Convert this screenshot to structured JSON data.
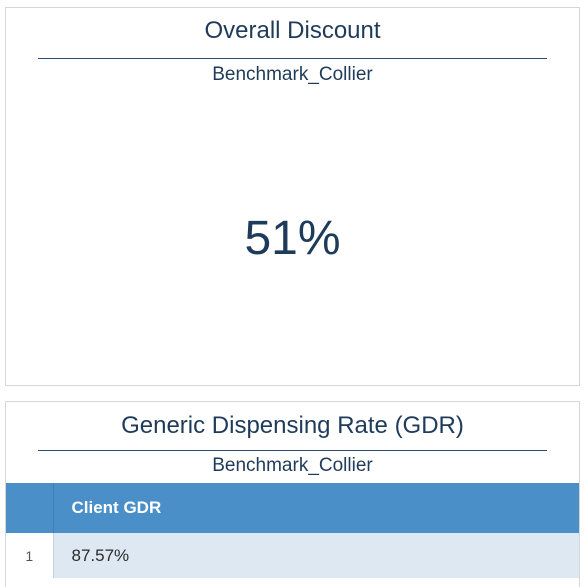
{
  "discount_card": {
    "title": "Overall Discount",
    "subtitle": "Benchmark_Collier",
    "value": "51%"
  },
  "gdr_card": {
    "title": "Generic Dispensing Rate (GDR)",
    "subtitle": "Benchmark_Collier",
    "table": {
      "columns": [
        "Client GDR"
      ],
      "rows": [
        {
          "index": "1",
          "client_gdr": "87.57%"
        }
      ]
    }
  },
  "colors": {
    "title_text": "#1f3b5a",
    "table_header_bg": "#4a8fc8",
    "table_row_bg": "#dde8f2",
    "card_border": "#d6d6d6"
  }
}
